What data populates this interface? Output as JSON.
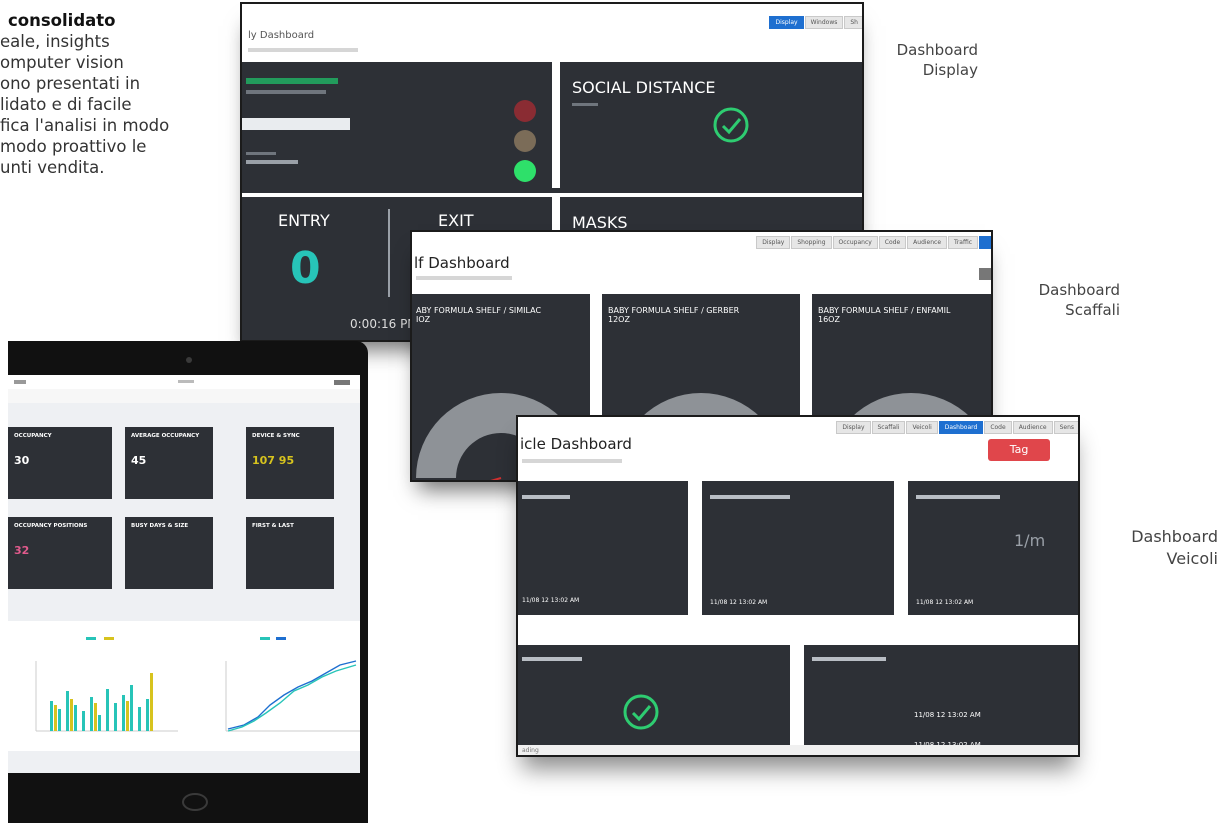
{
  "intro": {
    "heading": "consolidato",
    "lines": [
      "eale, insights",
      "omputer vision",
      "ono presentati in",
      "lidato e di facile",
      "fica l'analisi in modo",
      "modo proattivo le",
      "unti vendita."
    ]
  },
  "captions": {
    "display": [
      "Dashboard",
      "Display"
    ],
    "shelves": [
      "Dashboard",
      "Scaffali"
    ],
    "vehicles": [
      "Dashboard",
      "Veicoli"
    ]
  },
  "colors": {
    "panel": "#2d3036",
    "accent_teal": "#27c4b8",
    "ok_green": "#2ecc71",
    "alert_red": "#e0464b",
    "brand_blue": "#1e6fd0"
  },
  "display_dashboard": {
    "title": "ly Dashboard",
    "tabs": [
      "Display",
      "Windows",
      "Sh"
    ],
    "panels": {
      "social_distance": "SOCIAL DISTANCE",
      "entry": "ENTRY",
      "exit": "EXIT",
      "entry_value": "0",
      "masks": "MASKS",
      "time": "0:00:16 PM"
    },
    "traffic_light_icons": [
      "red-light-icon",
      "amber-light-icon",
      "green-light-icon"
    ]
  },
  "shelf_dashboard": {
    "title": "lf Dashboard",
    "panels": [
      {
        "title": "ABY FORMULA SHELF / SIMILAC",
        "line2": "IOZ"
      },
      {
        "title": "BABY FORMULA SHELF / GERBER",
        "line2": "12OZ"
      },
      {
        "title": "BABY FORMULA SHELF / ENFAMIL",
        "line2": "16OZ"
      }
    ]
  },
  "vehicle_dashboard": {
    "title": "icle Dashboard",
    "alert_label": "Tag",
    "tabs": [
      "Display",
      "Scaffali",
      "Veicoli",
      "Dashboard",
      "Code",
      "Audience",
      "Sens"
    ],
    "panels": {
      "right_value": "1/m",
      "row_value_1": "11/08 12 13:02 AM",
      "row_value_2": "11/08 12 13:02 AM",
      "row_value_3": "11/08 12 13:02 AM",
      "bottom_row_1": "11/08 12 13:02 AM",
      "bottom_row_2": "11/08 12 13:02 AM"
    },
    "status_bar": "ading"
  },
  "tablet": {
    "cards": [
      {
        "title": "OCCUPANCY",
        "value": "30",
        "accent": "#ffffff"
      },
      {
        "title": "AVERAGE OCCUPANCY",
        "value": "45",
        "accent": "#ffffff"
      },
      {
        "title": "DEVICE & SYNC",
        "value": "107 95",
        "accent": "#d7c31e"
      },
      {
        "title": "OCCUPANCY POSITIONS",
        "value": "32",
        "accent": "#e05a8c"
      },
      {
        "title": "BUSY DAYS & SIZE",
        "value": "",
        "accent": "#ffffff"
      },
      {
        "title": "FIRST & LAST",
        "value": "",
        "accent": "#ffffff"
      }
    ],
    "charts": [
      "bar-chart",
      "line-chart"
    ]
  }
}
